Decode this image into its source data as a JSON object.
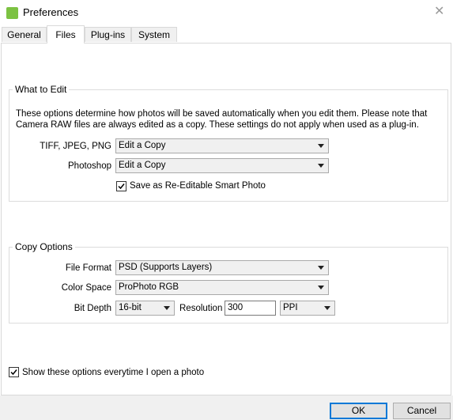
{
  "window": {
    "title": "Preferences",
    "app_icon": "app-logo-icon",
    "close_icon": "close-icon"
  },
  "tabs": [
    {
      "label": "General",
      "active": false
    },
    {
      "label": "Files",
      "active": true
    },
    {
      "label": "Plug-ins",
      "active": false
    },
    {
      "label": "System",
      "active": false
    }
  ],
  "what_to_edit": {
    "title": "What to Edit",
    "description_line1": "These options determine how photos will be saved automatically when you edit them.  Please note that",
    "description_line2": "Camera RAW files are always edited as a copy.  These settings do not apply when used as a plug-in.",
    "tiff_label": "TIFF, JPEG, PNG",
    "tiff_value": "Edit a Copy",
    "photoshop_label": "Photoshop",
    "photoshop_value": "Edit a Copy",
    "smart_photo_label": "Save as Re-Editable Smart Photo",
    "smart_photo_checked": true
  },
  "copy_options": {
    "title": "Copy Options",
    "file_format_label": "File Format",
    "file_format_value": "PSD (Supports Layers)",
    "color_space_label": "Color Space",
    "color_space_value": "ProPhoto RGB",
    "bit_depth_label": "Bit Depth",
    "bit_depth_value": "16-bit",
    "resolution_label": "Resolution",
    "resolution_value": "300",
    "resolution_unit": "PPI"
  },
  "show_options": {
    "label": "Show these options everytime I open a photo",
    "checked": true
  },
  "buttons": {
    "ok": "OK",
    "cancel": "Cancel"
  },
  "colors": {
    "accent": "#0078d7",
    "app_icon": "#7cc242",
    "footer": "#f0f0f0"
  }
}
